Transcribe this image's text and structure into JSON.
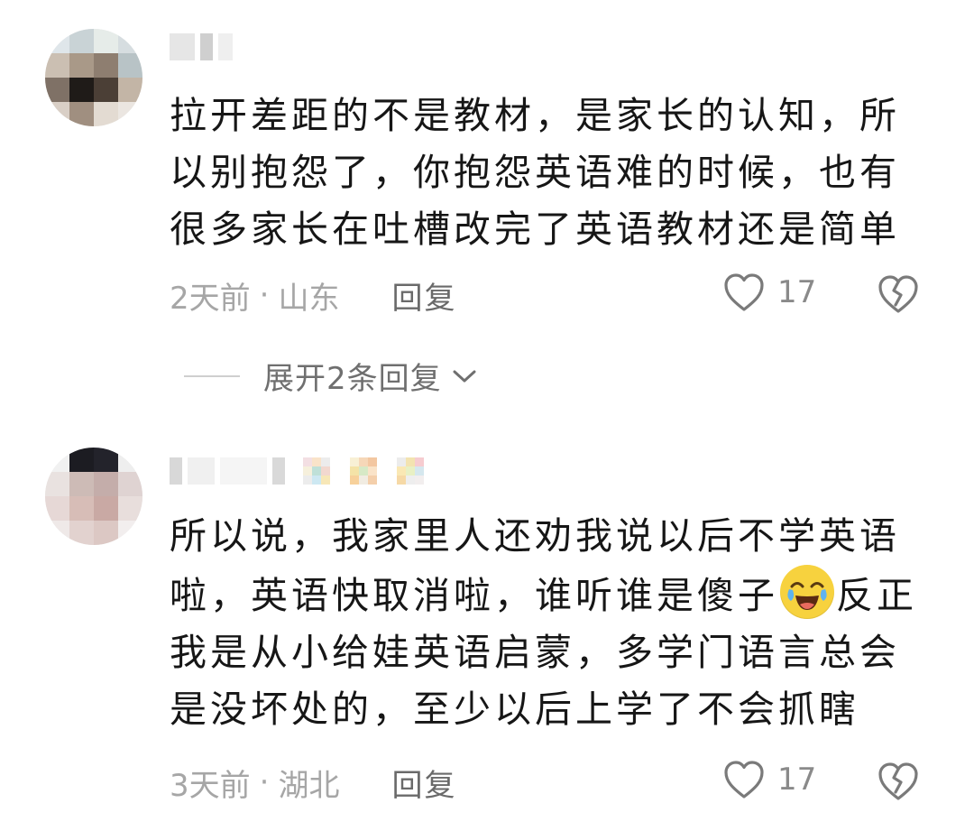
{
  "comments": [
    {
      "username": "",
      "text": "拉开差距的不是教材，是家长的认知，所以别抱怨了，你抱怨英语难的时候，也有很多家长在吐槽改完了英语教材还是简单",
      "time": "2天前",
      "location": "山东",
      "reply_label": "回复",
      "likes": "17",
      "expand_label": "展开2条回复"
    },
    {
      "username": "",
      "text_before_emoji": "所以说，我家里人还劝我说以后不学英语啦，英语快取消啦，谁听谁是傻子",
      "emoji": "laughing-crying-emoji",
      "text_after_emoji": "反正我是从小给娃英语启蒙，多学门语言总会是没坏处的，至少以后上学了不会抓瞎",
      "time": "3天前",
      "location": "湖北",
      "reply_label": "回复",
      "likes": "17"
    }
  ],
  "icons": {
    "like": "heart-outline-icon",
    "dislike": "broken-heart-icon",
    "expand": "chevron-down-icon"
  },
  "colors": {
    "text": "#161616",
    "meta": "#a6a6a6",
    "reply": "#6a6a6a"
  }
}
